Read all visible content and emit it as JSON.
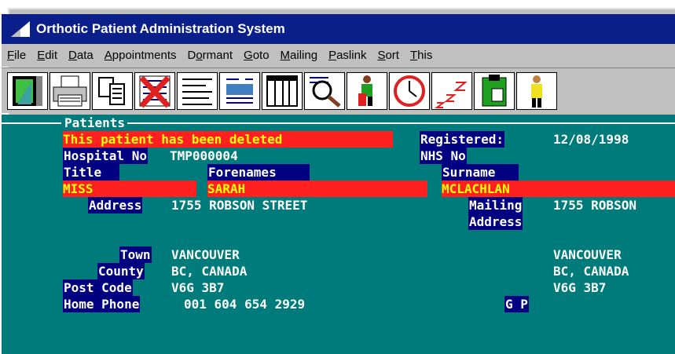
{
  "window": {
    "title": "Orthotic Patient Administration System"
  },
  "menu": [
    {
      "label": "File",
      "accel": "F"
    },
    {
      "label": "Edit",
      "accel": "E"
    },
    {
      "label": "Data",
      "accel": "D"
    },
    {
      "label": "Appointments",
      "accel": "A"
    },
    {
      "label": "Dormant",
      "accel": "o"
    },
    {
      "label": "Goto",
      "accel": "G"
    },
    {
      "label": "Mailing",
      "accel": "M"
    },
    {
      "label": "Paslink",
      "accel": "P"
    },
    {
      "label": "Sort",
      "accel": "S"
    },
    {
      "label": "This",
      "accel": "T"
    }
  ],
  "toolbar": [
    {
      "icon": "exit-door-icon"
    },
    {
      "icon": "printer-icon"
    },
    {
      "icon": "copy-pages-icon"
    },
    {
      "icon": "delete-record-icon"
    },
    {
      "icon": "list-lines-icon"
    },
    {
      "icon": "document-list-icon"
    },
    {
      "icon": "columns-icon"
    },
    {
      "icon": "find-magnifier-icon"
    },
    {
      "icon": "patient-person-icon"
    },
    {
      "icon": "clock-icon"
    },
    {
      "icon": "sleep-dormant-icon"
    },
    {
      "icon": "clipboard-icon"
    },
    {
      "icon": "staff-person-icon"
    }
  ],
  "patients": {
    "section_title": "Patients",
    "deleted_notice": "This patient has been deleted",
    "registered_label": "Registered:",
    "registered_value": "12/08/1998",
    "hospital_no_label": "Hospital No",
    "hospital_no_value": "TMP000004",
    "nhs_no_label": "NHS No",
    "nhs_no_value": "",
    "title_label": "Title",
    "forenames_label": "Forenames",
    "surname_label": "Surname",
    "title_value": "MISS",
    "forenames_value": "SARAH",
    "surname_value": "MCLACHLAN",
    "address_label": "Address",
    "address_value": "1755 ROBSON STREET",
    "mailing_label": "Mailing",
    "mailing_label2": "Address",
    "mailing_value": "1755 ROBSON",
    "town_label": "Town",
    "town_value": "VANCOUVER",
    "mailing_town": "VANCOUVER",
    "county_label": "County",
    "county_value": "BC, CANADA",
    "mailing_county": "BC, CANADA",
    "postcode_label": "Post Code",
    "postcode_value": "V6G 3B7",
    "mailing_postcode": "V6G 3B7",
    "home_phone_label": "Home Phone",
    "home_phone_value": "001 604 654 2929",
    "gp_label": "G P"
  },
  "colors": {
    "titlebar": "#0a1f8a",
    "screen_bg": "#007b7b",
    "label_bg": "#000080",
    "alert_bg": "#ff2020",
    "alert_fg": "#ffff00"
  }
}
